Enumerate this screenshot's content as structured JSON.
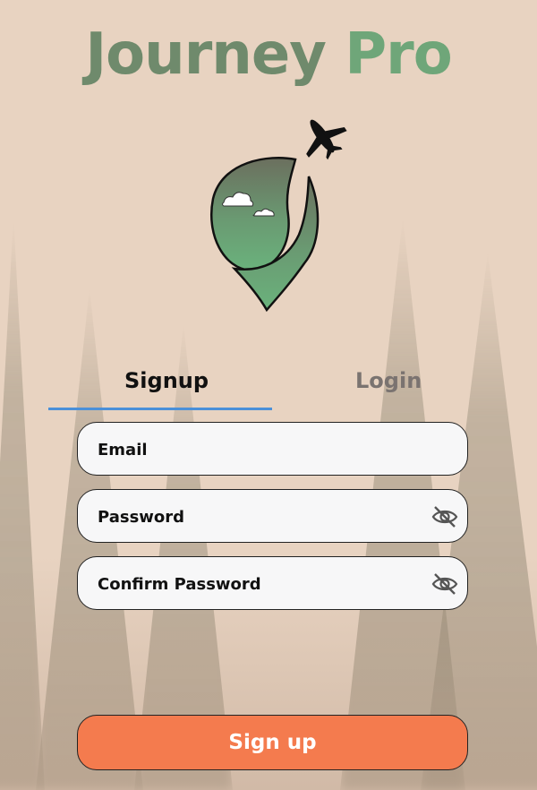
{
  "header": {
    "title_part1": "Journey",
    "title_part2": "Pro"
  },
  "logo": {
    "icon": "map-pin-globe-with-airplane",
    "colors": {
      "pin_top": "#6b7a66",
      "pin_bottom": "#6ab27c",
      "outline": "#111111"
    }
  },
  "tabs": [
    {
      "label": "Signup",
      "active": true
    },
    {
      "label": "Login",
      "active": false
    }
  ],
  "form": {
    "email_placeholder": "Email",
    "password_placeholder": "Password",
    "confirm_placeholder": "Confirm Password",
    "visibility_icon": "eye-off-icon"
  },
  "submit": {
    "label": "Sign up"
  },
  "colors": {
    "background": "#e8d3c1",
    "accent_button": "#f47b4e",
    "tab_underline": "#4a90d9",
    "title_green_dark": "#6f8a6c",
    "title_green_light": "#6fa679"
  }
}
